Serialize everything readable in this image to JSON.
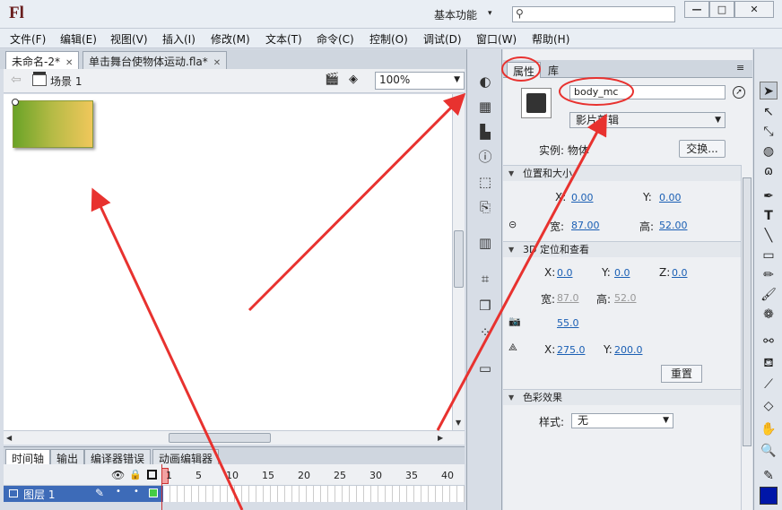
{
  "titlebar": {
    "logo": "Fl",
    "workspace": "基本功能",
    "win_min": "—",
    "win_max": "□",
    "win_close": "✕"
  },
  "menu": [
    "文件(F)",
    "编辑(E)",
    "视图(V)",
    "插入(I)",
    "修改(M)",
    "文本(T)",
    "命令(C)",
    "控制(O)",
    "调试(D)",
    "窗口(W)",
    "帮助(H)"
  ],
  "doc_tabs": [
    {
      "label": "未命名-2*"
    },
    {
      "label": "单击舞台使物体运动.fla*"
    }
  ],
  "scene": {
    "label": "场景 1",
    "zoom": "100%"
  },
  "timeline": {
    "tabs": [
      "时间轴",
      "输出",
      "编译器错误",
      "动画编辑器"
    ],
    "frame_numbers": [
      "1",
      "5",
      "10",
      "15",
      "20",
      "25",
      "30",
      "35",
      "40"
    ],
    "layer_name": "图层 1"
  },
  "properties": {
    "tabs": [
      "属性",
      "库"
    ],
    "instance_name": "body_mc",
    "symbol_type": "影片剪辑",
    "instance_label": "实例: 物体",
    "swap_label": "交换...",
    "sections": {
      "pos_size": "位置和大小",
      "pos3d": "3D 定位和查看",
      "color": "色彩效果"
    },
    "pos": {
      "x_label": "X:",
      "x": "0.00",
      "y_label": "Y:",
      "y": "0.00"
    },
    "size": {
      "w_label": "宽:",
      "w": "87.00",
      "h_label": "高:",
      "h": "52.00"
    },
    "pos3d": {
      "x_label": "X:",
      "x": "0.0",
      "y_label": "Y:",
      "y": "0.0",
      "z_label": "Z:",
      "z": "0.0"
    },
    "size3d": {
      "w_label": "宽:",
      "w": "87.0",
      "h_label": "高:",
      "h": "52.0"
    },
    "perspective": "55.0",
    "vanish": {
      "x_label": "X:",
      "x": "275.0",
      "y_label": "Y:",
      "y": "200.0"
    },
    "reset_label": "重置",
    "style_label": "样式:",
    "style_value": "无"
  },
  "colors": {
    "annotation": "#e8322f",
    "layer_selected": "#3d6bb8",
    "link_value": "#1a5fb4"
  }
}
